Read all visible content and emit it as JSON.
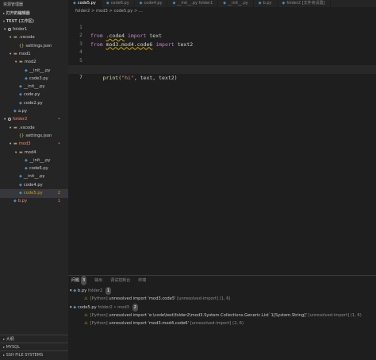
{
  "sidebar": {
    "header": "资源管理器",
    "open_editors": "打开的编辑器",
    "workspace": "TEST (工作区)",
    "items": [
      {
        "label": "folder1",
        "kind": "root",
        "depth": 0
      },
      {
        "label": ".vscode",
        "kind": "folder",
        "depth": 1
      },
      {
        "label": "settings.json",
        "kind": "json",
        "depth": 2
      },
      {
        "label": "mod1",
        "kind": "folder",
        "depth": 1
      },
      {
        "label": "mod2",
        "kind": "folder",
        "depth": 2
      },
      {
        "label": "__init__.py",
        "kind": "py",
        "depth": 3
      },
      {
        "label": "code3.py",
        "kind": "py",
        "depth": 3
      },
      {
        "label": "__init__.py",
        "kind": "py",
        "depth": 2
      },
      {
        "label": "code.py",
        "kind": "py",
        "depth": 2
      },
      {
        "label": "code2.py",
        "kind": "py",
        "depth": 2
      },
      {
        "label": "a.py",
        "kind": "py",
        "depth": 1
      },
      {
        "label": "folder2",
        "kind": "root",
        "depth": 0,
        "status": "error",
        "badge": "•"
      },
      {
        "label": ".vscode",
        "kind": "folder",
        "depth": 1
      },
      {
        "label": "settings.json",
        "kind": "json",
        "depth": 2
      },
      {
        "label": "mod3",
        "kind": "folder",
        "depth": 1,
        "status": "error",
        "badge": "•"
      },
      {
        "label": "mod4",
        "kind": "folder",
        "depth": 2
      },
      {
        "label": "__init__.py",
        "kind": "py",
        "depth": 3
      },
      {
        "label": "code6.py",
        "kind": "py",
        "depth": 3
      },
      {
        "label": "__init__.py",
        "kind": "py",
        "depth": 2
      },
      {
        "label": "code4.py",
        "kind": "py",
        "depth": 2
      },
      {
        "label": "code5.py",
        "kind": "py",
        "depth": 2,
        "status": "warn",
        "badge": "2",
        "selected": true
      },
      {
        "label": "b.py",
        "kind": "py",
        "depth": 1,
        "status": "error",
        "badge": "1"
      }
    ],
    "bottom_sections": [
      "大纲",
      "MYSQL",
      "SSH FILE SYSTEMS"
    ]
  },
  "tabs": [
    {
      "label": "code5.py",
      "active": true
    },
    {
      "label": "code6.py",
      "active": false
    },
    {
      "label": "code4.py",
      "active": false
    },
    {
      "label": "__init__.py folder1",
      "active": false
    },
    {
      "label": "__init__.py",
      "active": false
    },
    {
      "label": "b.py",
      "active": false
    },
    {
      "label": "folder2 [文件夹设置]",
      "active": false
    }
  ],
  "breadcrumb": "folder2 > mod3 > code5.py > ...",
  "editor": {
    "line_numbers": [
      "1",
      "2",
      "3",
      "4",
      "5",
      "6",
      "7"
    ]
  },
  "panel": {
    "tabs": [
      {
        "label": "问题",
        "count": "3",
        "active": true
      },
      {
        "label": "输出",
        "active": false
      },
      {
        "label": "调试控制台",
        "active": false
      },
      {
        "label": "终端",
        "active": false
      }
    ],
    "groups": [
      {
        "file": "b.py",
        "path": "folder2",
        "count": "1",
        "items": [
          {
            "source": "[Python]",
            "message": "unresolved import 'mod3.code5'",
            "rule": "[unresolved-import]",
            "pos": "(1, 6)"
          }
        ]
      },
      {
        "file": "code5.py",
        "path": "folder2 • mod3",
        "count": "2",
        "items": [
          {
            "source": "[Python]",
            "message": "unresolved import 'e:\\code\\test\\folder2\\mod3.System.Collections.Generic.List`1[System.String]'",
            "rule": "[unresolved-import]",
            "pos": "(1, 6)"
          },
          {
            "source": "[Python]",
            "message": "unresolved import 'mod3.mod4.code6'",
            "rule": "[unresolved-import]",
            "pos": "(2, 6)"
          }
        ]
      }
    ]
  },
  "colors": {
    "background": "#1e1e1e",
    "sidebar": "#252526",
    "keyword": "#c586c0",
    "function": "#dcdcaa",
    "string": "#ce9178",
    "warning": "#cca700",
    "error": "#f48771"
  }
}
